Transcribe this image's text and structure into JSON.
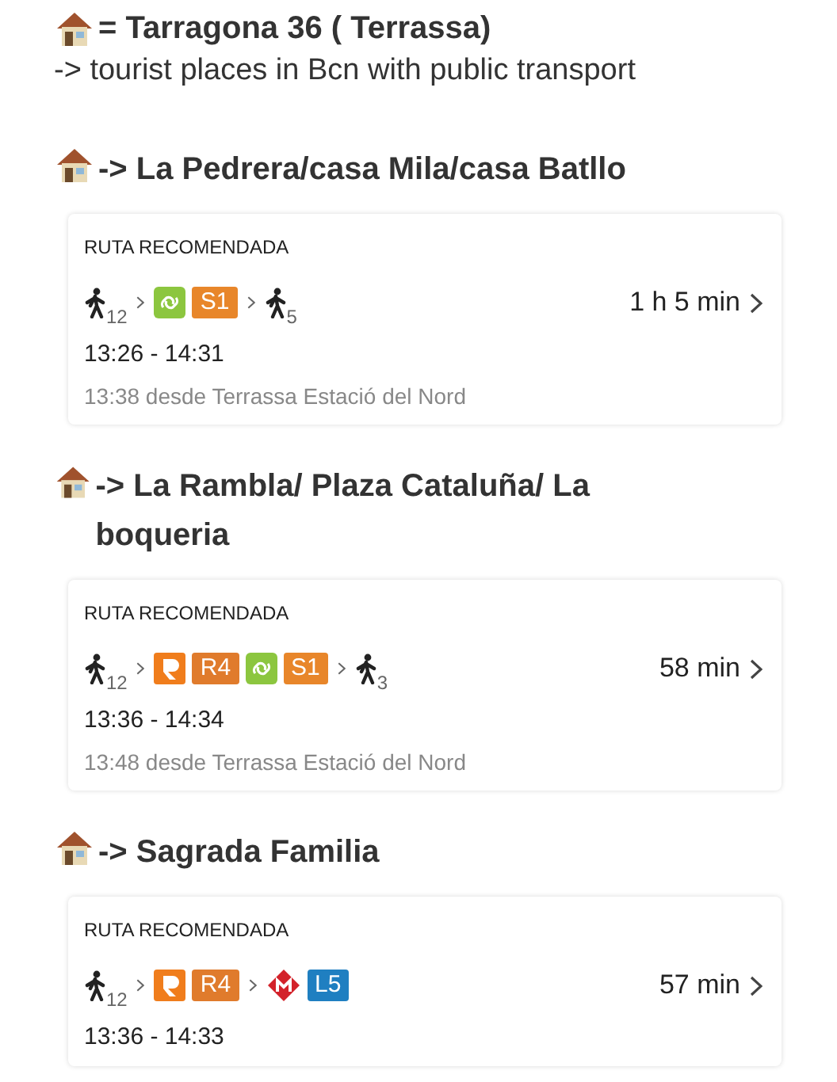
{
  "home": {
    "title": "= Tarragona 36 ( Terrassa)",
    "subtitle": "-> tourist places in Bcn with public transport"
  },
  "routes": [
    {
      "heading": "-> La Pedrera/casa Mila/casa Batllo",
      "label": "RUTA RECOMENDADA",
      "duration": "1 h 5 min",
      "times": "13:26 - 14:31",
      "departure": "13:38 desde Terrassa Estació del Nord",
      "groups": [
        [
          {
            "kind": "walk",
            "minutes": "12"
          }
        ],
        [
          {
            "kind": "fgc"
          },
          {
            "kind": "line",
            "text": "S1",
            "color": "#e8862a"
          }
        ],
        [
          {
            "kind": "walk",
            "minutes": "5"
          }
        ]
      ]
    },
    {
      "heading": "-> La Rambla/ Plaza Cataluña/ La boqueria",
      "label": "RUTA RECOMENDADA",
      "duration": "58 min",
      "times": "13:36 - 14:34",
      "departure": "13:48 desde Terrassa Estació del Nord",
      "groups": [
        [
          {
            "kind": "walk",
            "minutes": "12"
          }
        ],
        [
          {
            "kind": "rodalies"
          },
          {
            "kind": "line",
            "text": "R4",
            "color": "#e07b2c"
          },
          {
            "kind": "fgc"
          },
          {
            "kind": "line",
            "text": "S1",
            "color": "#e8862a"
          }
        ],
        [
          {
            "kind": "walk",
            "minutes": "3"
          }
        ]
      ]
    },
    {
      "heading": "-> Sagrada Familia",
      "label": "RUTA RECOMENDADA",
      "duration": "57 min",
      "times": "13:36 - 14:33",
      "groups": [
        [
          {
            "kind": "walk",
            "minutes": "12"
          }
        ],
        [
          {
            "kind": "rodalies"
          },
          {
            "kind": "line",
            "text": "R4",
            "color": "#e07b2c"
          }
        ],
        [
          {
            "kind": "metro"
          },
          {
            "kind": "line",
            "text": "L5",
            "color": "#1f7fc1"
          }
        ]
      ]
    }
  ]
}
